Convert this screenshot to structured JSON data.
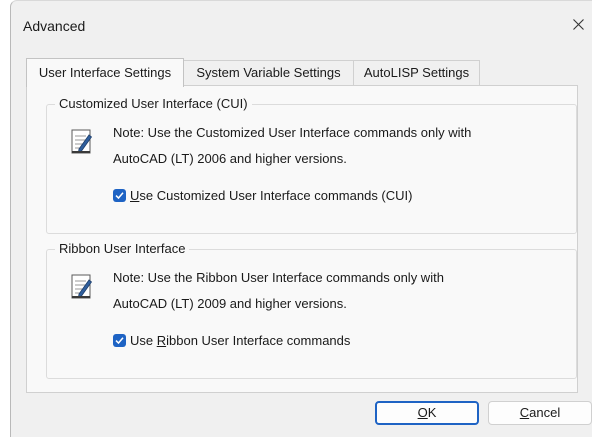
{
  "window": {
    "title": "Advanced"
  },
  "tabs": [
    {
      "label": "User Interface Settings",
      "active": true
    },
    {
      "label": "System Variable Settings",
      "active": false
    },
    {
      "label": "AutoLISP Settings",
      "active": false
    }
  ],
  "cui_group": {
    "legend": "Customized User Interface (CUI)",
    "note_line1": "Note: Use the Customized User Interface commands only with",
    "note_line2": "AutoCAD (LT) 2006 and higher versions.",
    "checkbox": {
      "checked": true,
      "mnemonic": "U",
      "label_rest": "se Customized User Interface commands (CUI)"
    }
  },
  "ribbon_group": {
    "legend": "Ribbon User Interface",
    "note_line1": "Note: Use the Ribbon User Interface commands only with",
    "note_line2": "AutoCAD (LT) 2009 and higher versions.",
    "checkbox": {
      "checked": true,
      "label_before": "Use ",
      "mnemonic": "R",
      "label_rest": "ibbon User Interface commands"
    }
  },
  "buttons": {
    "ok": {
      "mnemonic": "O",
      "rest": "K"
    },
    "cancel": {
      "mnemonic": "C",
      "rest": "ancel"
    }
  },
  "colors": {
    "accent": "#1e63c4",
    "dialog_bg": "#f0f0f0",
    "panel_bg": "#f9f9f9"
  },
  "icons": {
    "close": "close-icon",
    "note": "note-icon",
    "check": "checkmark-icon"
  }
}
